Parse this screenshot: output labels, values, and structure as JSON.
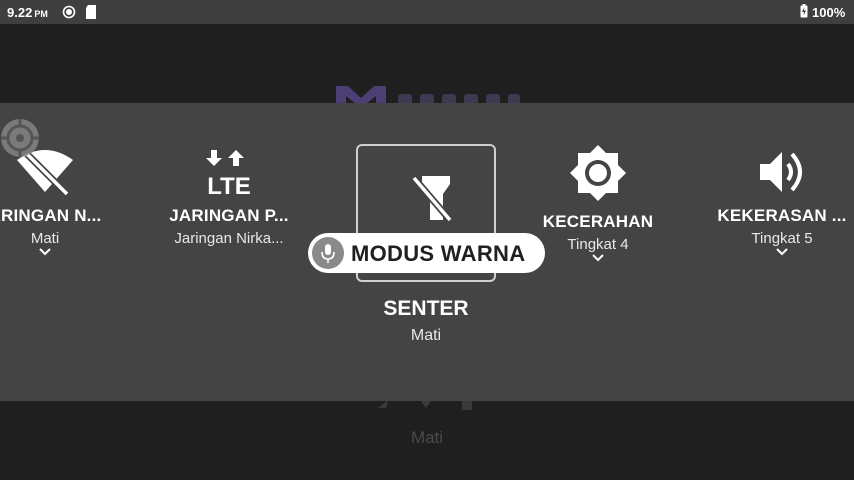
{
  "status_bar": {
    "time": "9.22",
    "ampm": "PM",
    "battery": "100%"
  },
  "background": {
    "mati_label": "Mati"
  },
  "tiles": [
    {
      "title": "ARINGAN N...",
      "subtitle": "Mati",
      "icon": "wifi-off-icon"
    },
    {
      "title": "JARINGAN P...",
      "subtitle": "Jaringan Nirka...",
      "icon": "lte-data-icon",
      "icon_text": "LTE"
    },
    {
      "title": "SENTER",
      "subtitle": "Mati",
      "icon": "flashlight-off-icon"
    },
    {
      "title": "KECERAHAN",
      "subtitle": "Tingkat 4",
      "icon": "brightness-icon"
    },
    {
      "title": "KEKERASAN ...",
      "subtitle": "Tingkat 5",
      "icon": "volume-icon"
    }
  ],
  "voice_prompt": {
    "text": "MODUS WARNA",
    "icon": "microphone-icon"
  },
  "colors": {
    "panel": "#444444",
    "status_bar": "#3f3f3f",
    "background": "#1f1f1f",
    "logo": "#4b3f73"
  }
}
